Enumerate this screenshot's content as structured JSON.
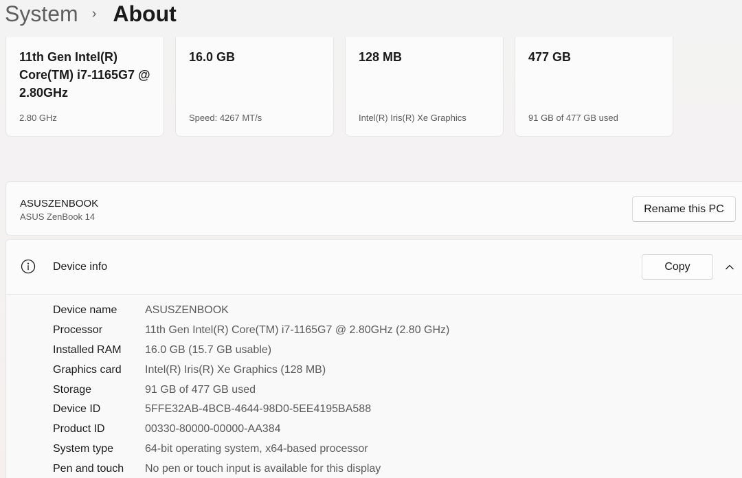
{
  "breadcrumb": {
    "parent": "System",
    "separator": "›",
    "current": "About"
  },
  "spec_cards": [
    {
      "value": "11th Gen Intel(R) Core(TM) i7-1165G7 @ 2.80GHz",
      "sub": "2.80 GHz"
    },
    {
      "value": "16.0 GB",
      "sub": "Speed: 4267 MT/s"
    },
    {
      "value": "128 MB",
      "sub": "Intel(R) Iris(R) Xe Graphics"
    },
    {
      "value": "477 GB",
      "sub": "91 GB of 477 GB used"
    }
  ],
  "pc": {
    "name": "ASUSZENBOOK",
    "model": "ASUS ZenBook 14",
    "rename_label": "Rename this PC"
  },
  "device_info": {
    "title": "Device info",
    "copy_label": "Copy",
    "expanded": true,
    "rows": [
      {
        "label": "Device name",
        "value": "ASUSZENBOOK"
      },
      {
        "label": "Processor",
        "value": "11th Gen Intel(R) Core(TM) i7-1165G7 @ 2.80GHz (2.80 GHz)"
      },
      {
        "label": "Installed RAM",
        "value": "16.0 GB (15.7 GB usable)"
      },
      {
        "label": "Graphics card",
        "value": "Intel(R) Iris(R) Xe Graphics (128 MB)"
      },
      {
        "label": "Storage",
        "value": "91 GB of 477 GB used"
      },
      {
        "label": "Device ID",
        "value": "5FFE32AB-4BCB-4644-98D0-5EE4195BA588"
      },
      {
        "label": "Product ID",
        "value": "00330-80000-00000-AA384"
      },
      {
        "label": "System type",
        "value": "64-bit operating system, x64-based processor"
      },
      {
        "label": "Pen and touch",
        "value": "No pen or touch input is available for this display"
      }
    ]
  },
  "icons": {
    "info": "info-icon",
    "chevron": "chevron-up-icon"
  },
  "colors": {
    "text_primary": "#1a1a1a",
    "text_secondary": "#5a5a5a",
    "card_background": "#fbfbfb",
    "border": "#e5e5e5"
  }
}
